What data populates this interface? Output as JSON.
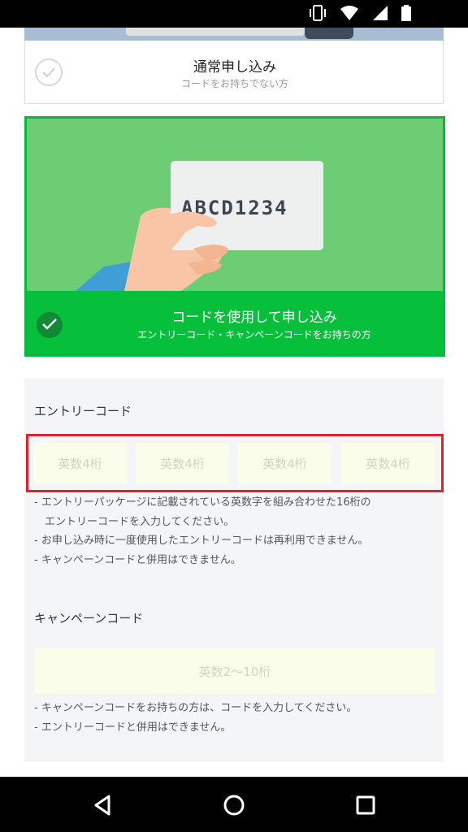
{
  "status_bar": {
    "icons": [
      "vibrate-icon",
      "wifi-icon",
      "signal-icon",
      "battery-icon"
    ]
  },
  "normal_option": {
    "title": "通常申し込み",
    "subtitle": "コードをお持ちでない方"
  },
  "code_option": {
    "card_text": "ABCD1234",
    "title": "コードを使用して申し込み",
    "subtitle": "エントリーコード・キャンペーンコードをお持ちの方",
    "selected": true
  },
  "entry_code": {
    "label": "エントリーコード",
    "inputs": [
      {
        "placeholder": "英数4桁",
        "value": ""
      },
      {
        "placeholder": "英数4桁",
        "value": ""
      },
      {
        "placeholder": "英数4桁",
        "value": ""
      },
      {
        "placeholder": "英数4桁",
        "value": ""
      }
    ],
    "notes": [
      "- エントリーパッケージに記載されている英数字を組み合わせた16桁の",
      "エントリーコードを入力してください。",
      "- お申し込み時に一度使用したエントリーコードは再利用できません。",
      "- キャンペーンコードと併用はできません。"
    ]
  },
  "campaign_code": {
    "label": "キャンペーンコード",
    "placeholder": "英数2〜10桁",
    "notes": [
      "- キャンペーンコードをお持ちの方は、コードを入力してください。",
      "- エントリーコードと併用はできません。"
    ]
  },
  "colors": {
    "accent_green": "#06c03c",
    "illustration_green": "#6ccd74",
    "highlight_red": "#e51f2b",
    "input_bg": "#fafde9"
  }
}
